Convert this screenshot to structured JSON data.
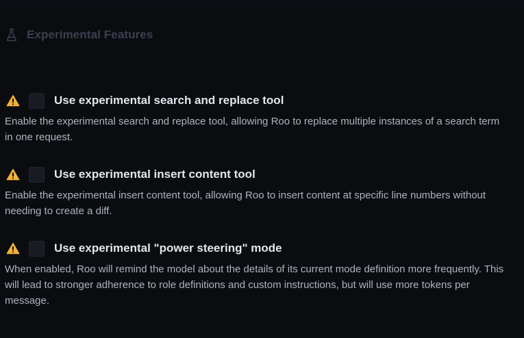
{
  "section": {
    "title": "Experimental Features",
    "icon": "flask-icon"
  },
  "colors": {
    "background": "#0b0c10",
    "warning": "#f2b13a",
    "section_title": "#39414f",
    "label": "#e3e6ec",
    "description": "#aeb4be"
  },
  "features": [
    {
      "label": "Use experimental search and replace tool",
      "description": "Enable the experimental search and replace tool, allowing Roo to replace multiple instances of a search term in one request.",
      "checked": false,
      "icon": "warning-icon"
    },
    {
      "label": "Use experimental insert content tool",
      "description": "Enable the experimental insert content tool, allowing Roo to insert content at specific line numbers without needing to create a diff.",
      "checked": false,
      "icon": "warning-icon"
    },
    {
      "label": "Use experimental \"power steering\" mode",
      "description": "When enabled, Roo will remind the model about the details of its current mode definition more frequently. This will lead to stronger adherence to role definitions and custom instructions, but will use more tokens per message.",
      "checked": false,
      "icon": "warning-icon"
    }
  ]
}
